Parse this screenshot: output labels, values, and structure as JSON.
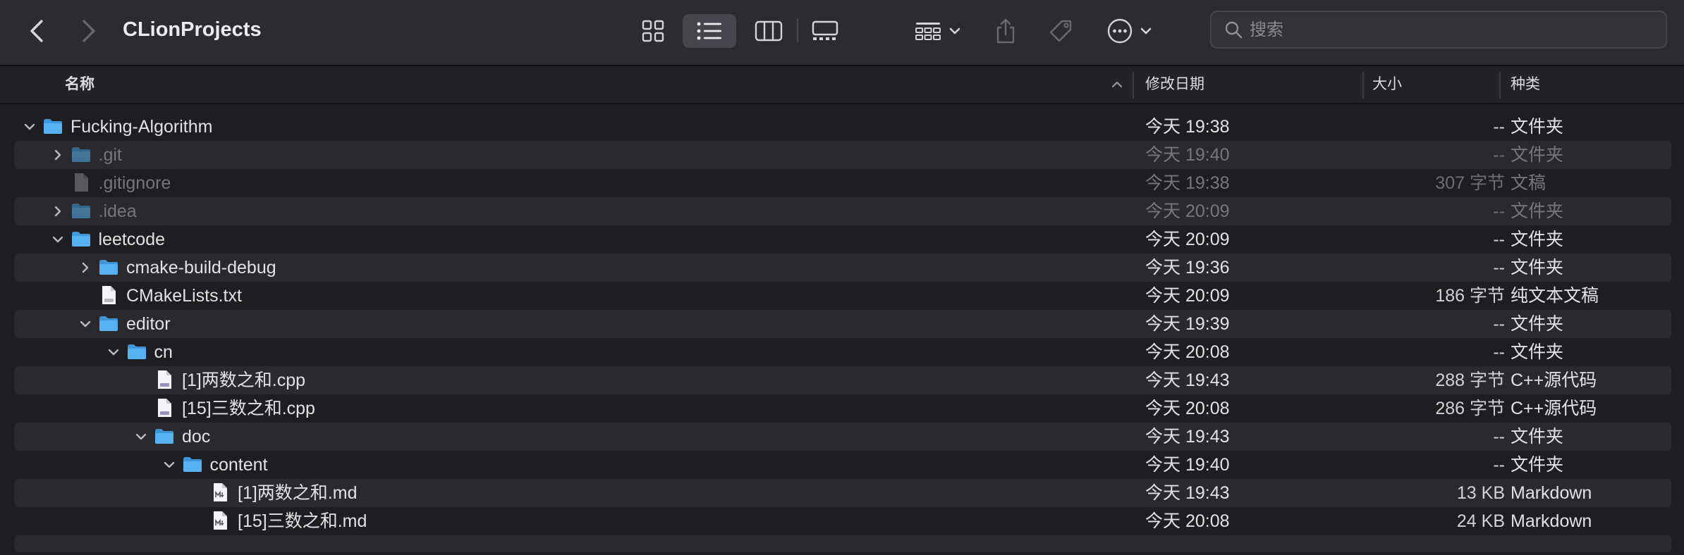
{
  "window": {
    "title": "CLionProjects"
  },
  "toolbar": {
    "back_icon": "chevron-left-icon",
    "forward_icon": "chevron-right-icon",
    "views": [
      "icons-view-icon",
      "list-view-icon",
      "columns-view-icon",
      "gallery-view-icon"
    ],
    "active_view": "list",
    "group_icon": "group-by-icon",
    "share_icon": "share-icon",
    "tag_icon": "tag-icon",
    "more_icon": "ellipsis-circle-icon"
  },
  "search": {
    "placeholder": "搜索",
    "value": ""
  },
  "columns": {
    "name": "名称",
    "date": "修改日期",
    "size": "大小",
    "kind": "种类"
  },
  "rows": [
    {
      "name": "Fucking-Algorithm",
      "date": "今天 19:38",
      "size": "--",
      "kind": "文件夹",
      "type": "folder",
      "depth": 0,
      "disclosure": "expanded",
      "dim": false
    },
    {
      "name": ".git",
      "date": "今天 19:40",
      "size": "--",
      "kind": "文件夹",
      "type": "folder",
      "depth": 1,
      "disclosure": "collapsed",
      "dim": true
    },
    {
      "name": ".gitignore",
      "date": "今天 19:38",
      "size": "307 字节",
      "kind": "文稿",
      "type": "doc",
      "depth": 1,
      "disclosure": "none",
      "dim": true
    },
    {
      "name": ".idea",
      "date": "今天 20:09",
      "size": "--",
      "kind": "文件夹",
      "type": "folder",
      "depth": 1,
      "disclosure": "collapsed",
      "dim": true
    },
    {
      "name": "leetcode",
      "date": "今天 20:09",
      "size": "--",
      "kind": "文件夹",
      "type": "folder",
      "depth": 1,
      "disclosure": "expanded",
      "dim": false
    },
    {
      "name": "cmake-build-debug",
      "date": "今天 19:36",
      "size": "--",
      "kind": "文件夹",
      "type": "folder",
      "depth": 2,
      "disclosure": "collapsed",
      "dim": false
    },
    {
      "name": "CMakeLists.txt",
      "date": "今天 20:09",
      "size": "186 字节",
      "kind": "纯文本文稿",
      "type": "txt",
      "depth": 2,
      "disclosure": "none",
      "dim": false
    },
    {
      "name": "editor",
      "date": "今天 19:39",
      "size": "--",
      "kind": "文件夹",
      "type": "folder",
      "depth": 2,
      "disclosure": "expanded",
      "dim": false
    },
    {
      "name": "cn",
      "date": "今天 20:08",
      "size": "--",
      "kind": "文件夹",
      "type": "folder",
      "depth": 3,
      "disclosure": "expanded",
      "dim": false
    },
    {
      "name": "[1]两数之和.cpp",
      "date": "今天 19:43",
      "size": "288 字节",
      "kind": "C++源代码",
      "type": "cpp",
      "depth": 4,
      "disclosure": "none",
      "dim": false
    },
    {
      "name": "[15]三数之和.cpp",
      "date": "今天 20:08",
      "size": "286 字节",
      "kind": "C++源代码",
      "type": "cpp",
      "depth": 4,
      "disclosure": "none",
      "dim": false
    },
    {
      "name": "doc",
      "date": "今天 19:43",
      "size": "--",
      "kind": "文件夹",
      "type": "folder",
      "depth": 4,
      "disclosure": "expanded",
      "dim": false
    },
    {
      "name": "content",
      "date": "今天 19:40",
      "size": "--",
      "kind": "文件夹",
      "type": "folder",
      "depth": 5,
      "disclosure": "expanded",
      "dim": false
    },
    {
      "name": "[1]两数之和.md",
      "date": "今天 19:43",
      "size": "13 KB",
      "kind": "Markdown",
      "type": "md",
      "depth": 6,
      "disclosure": "none",
      "dim": false
    },
    {
      "name": "[15]三数之和.md",
      "date": "今天 20:08",
      "size": "24 KB",
      "kind": "Markdown",
      "type": "md",
      "depth": 6,
      "disclosure": "none",
      "dim": false
    }
  ],
  "colors": {
    "folder": "#56b2f0",
    "folder_tab": "#3f97d8",
    "background": "#1e1e21",
    "row_alt": "#2a292d",
    "toolbar": "#2c2b2f"
  }
}
